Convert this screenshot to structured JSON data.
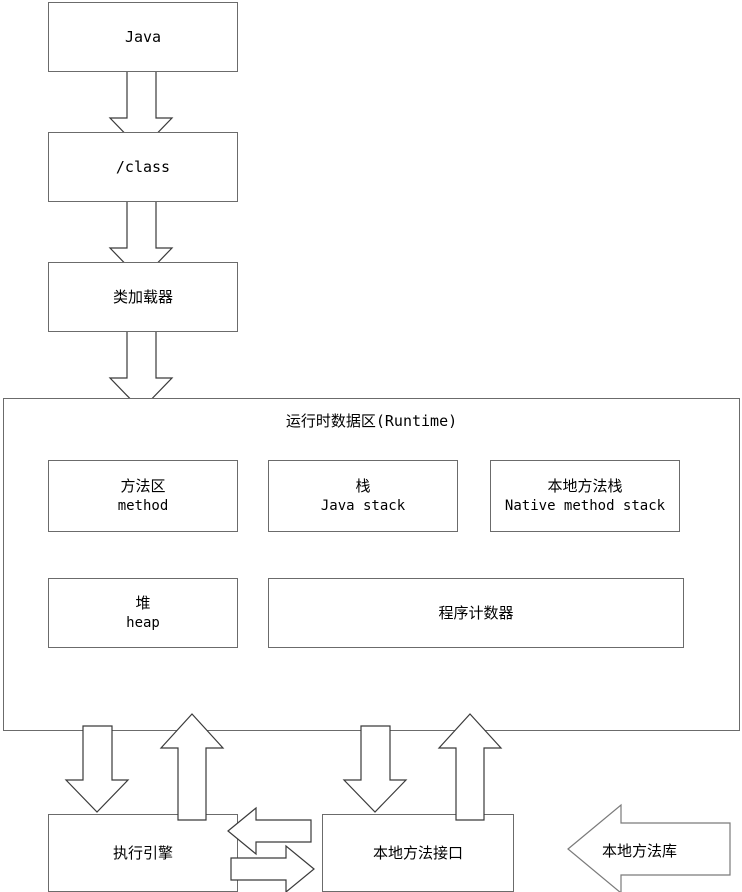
{
  "diagram": {
    "title_text": "运行时数据区(Runtime)",
    "nodes": {
      "java": {
        "label": "Java"
      },
      "class_file": {
        "label": "/class"
      },
      "class_loader": {
        "label": "类加载器"
      },
      "runtime_area": {
        "label": "运行时数据区(Runtime)"
      },
      "method_area": {
        "cn": "方法区",
        "en": "method"
      },
      "java_stack": {
        "cn": "栈",
        "en": "Java stack"
      },
      "native_method_stack": {
        "cn": "本地方法栈",
        "en": "Native method stack"
      },
      "heap": {
        "cn": "堆",
        "en": "heap"
      },
      "program_counter": {
        "cn": "程序计数器",
        "en": ""
      },
      "execution_engine": {
        "label": "执行引擎"
      },
      "native_method_interface": {
        "label": "本地方法接口"
      },
      "native_method_library": {
        "label": "本地方法库"
      }
    },
    "connectors": [
      {
        "name": "java-to-class",
        "kind": "block-arrow-down"
      },
      {
        "name": "class-to-classloader",
        "kind": "block-arrow-down"
      },
      {
        "name": "classloader-to-runtime",
        "kind": "block-arrow-down"
      },
      {
        "name": "runtime-to-execution-engine",
        "kind": "block-arrow-down"
      },
      {
        "name": "execution-engine-to-runtime",
        "kind": "block-arrow-up"
      },
      {
        "name": "runtime-to-native-interface",
        "kind": "block-arrow-down"
      },
      {
        "name": "native-interface-to-runtime",
        "kind": "block-arrow-up"
      },
      {
        "name": "native-interface-to-execution-engine",
        "kind": "block-arrow-left"
      },
      {
        "name": "execution-engine-to-native-interface",
        "kind": "block-arrow-right"
      },
      {
        "name": "native-library-arrow",
        "kind": "block-arrow-left-labeled"
      }
    ],
    "colors": {
      "stroke": "#3a3a3a",
      "box_stroke": "#6b6b6b",
      "background": "#ffffff",
      "text": "#000000"
    }
  }
}
